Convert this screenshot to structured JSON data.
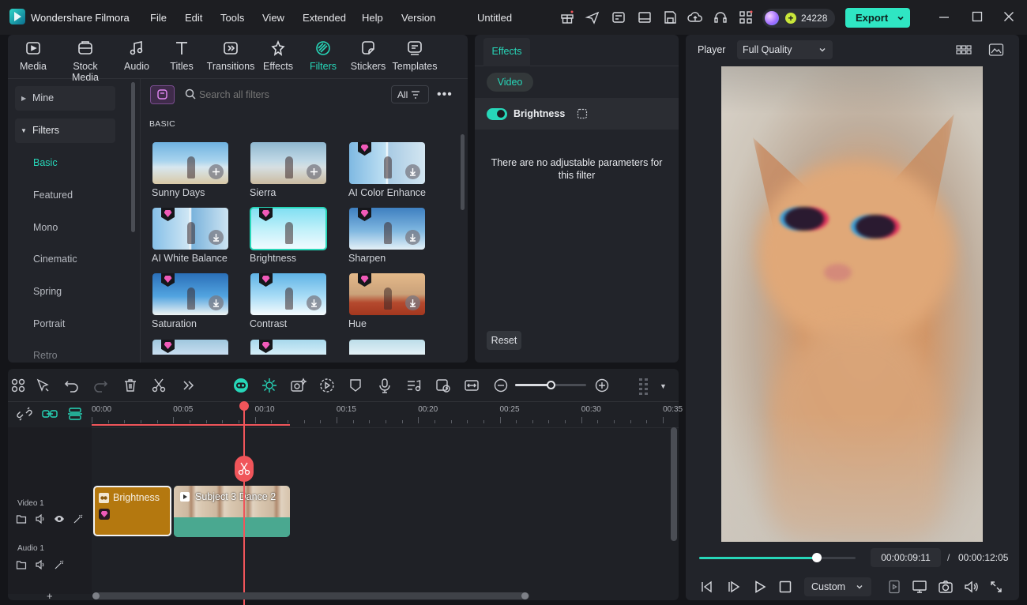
{
  "app": {
    "name": "Wondershare Filmora",
    "doc_title": "Untitled",
    "credits": "24228",
    "export_label": "Export"
  },
  "menu": [
    "File",
    "Edit",
    "Tools",
    "View",
    "Extended",
    "Help",
    "Version"
  ],
  "tabs": [
    {
      "label": "Media",
      "icon": "media-icon"
    },
    {
      "label": "Stock Media",
      "icon": "stock-media-icon"
    },
    {
      "label": "Audio",
      "icon": "audio-note-icon"
    },
    {
      "label": "Titles",
      "icon": "titles-icon"
    },
    {
      "label": "Transitions",
      "icon": "transitions-icon"
    },
    {
      "label": "Effects",
      "icon": "effects-icon"
    },
    {
      "label": "Filters",
      "icon": "filters-icon",
      "active": true
    },
    {
      "label": "Stickers",
      "icon": "stickers-icon"
    },
    {
      "label": "Templates",
      "icon": "templates-icon"
    }
  ],
  "sidebar": {
    "mine": "Mine",
    "filters": "Filters",
    "items": [
      "Basic",
      "Featured",
      "Mono",
      "Cinematic",
      "Spring",
      "Portrait",
      "Retro"
    ]
  },
  "search": {
    "placeholder": "Search all filters",
    "filter_all": "All"
  },
  "section_title": "BASIC",
  "filters_grid": [
    {
      "label": "Sunny Days",
      "premium": false
    },
    {
      "label": "Sierra",
      "premium": false
    },
    {
      "label": "AI Color Enhance",
      "premium": true
    },
    {
      "label": "AI White Balance",
      "premium": true
    },
    {
      "label": "Brightness",
      "premium": true,
      "selected": true
    },
    {
      "label": "Sharpen",
      "premium": true
    },
    {
      "label": "Saturation",
      "premium": true
    },
    {
      "label": "Contrast",
      "premium": true
    },
    {
      "label": "Hue",
      "premium": true
    }
  ],
  "effects_panel": {
    "tab": "Effects",
    "subtab": "Video",
    "filter_name": "Brightness",
    "message": "There are no adjustable parameters for this filter",
    "reset_label": "Reset"
  },
  "player": {
    "label": "Player",
    "quality": "Full Quality",
    "current_time": "00:00:09:11",
    "separator": "/",
    "total_time": "00:00:12:05",
    "zoom": "Custom",
    "progress": 0.78
  },
  "timeline": {
    "ticks": [
      "00:00",
      "00:05",
      "00:10",
      "00:15",
      "00:20",
      "00:25",
      "00:30",
      "00:35"
    ],
    "tracks": [
      {
        "name": "Video 1"
      },
      {
        "name": "Audio 1"
      }
    ],
    "clips": [
      {
        "label": "Brightness",
        "type": "filter"
      },
      {
        "label": "Subject 3 Dance 2",
        "type": "video"
      }
    ],
    "add_track": "+"
  },
  "colors": {
    "accent": "#27d7b9",
    "filter_clip": "#b4780f",
    "playhead": "#f0555a",
    "export_bg": "#2fe6c3"
  }
}
